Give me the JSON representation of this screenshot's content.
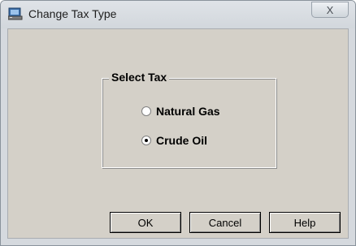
{
  "window": {
    "title": "Change Tax Type",
    "close_glyph": "X"
  },
  "group": {
    "label": "Select Tax",
    "options": [
      {
        "label": "Natural Gas",
        "checked": false
      },
      {
        "label": "Crude Oil",
        "checked": true
      }
    ]
  },
  "buttons": {
    "ok": "OK",
    "cancel": "Cancel",
    "help": "Help"
  }
}
